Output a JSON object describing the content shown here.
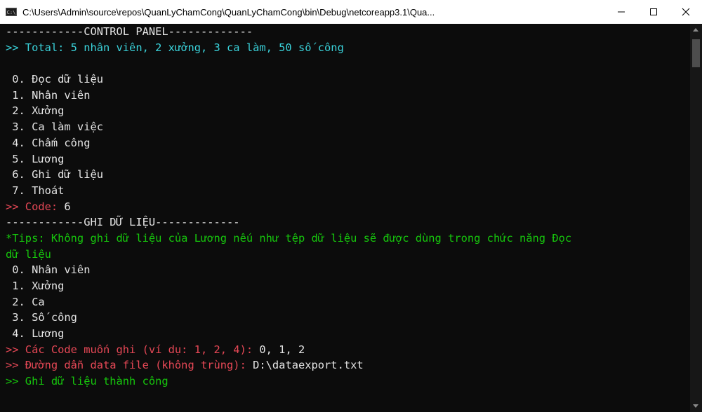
{
  "window": {
    "app_icon": "C:\\",
    "title": "C:\\Users\\Admin\\source\\repos\\QuanLyChamCong\\QuanLyChamCong\\bin\\Debug\\netcoreapp3.1\\Qua...",
    "icons": {
      "app": "console-app-icon",
      "minimize": "minimize-icon",
      "maximize": "maximize-icon",
      "close": "close-icon"
    }
  },
  "colors": {
    "cyan": "#3ad3db",
    "white": "#e5e5e5",
    "red": "#e74856",
    "green": "#16c60c"
  },
  "console": {
    "header_panel": "------------CONTROL PANEL-------------",
    "total_line": ">> Total: 5 nhân viên, 2 xưởng, 3 ca làm, 50 số công",
    "blank": "",
    "menu": [
      " 0. Đọc dữ liệu",
      " 1. Nhân viên",
      " 2. Xưởng",
      " 3. Ca làm việc",
      " 4. Chấm công",
      " 5. Lương",
      " 6. Ghi dữ liệu",
      " 7. Thoát"
    ],
    "code_prompt": ">> Code: ",
    "code_value": "6",
    "header_write": "------------GHI DỮ LIỆU-------------",
    "tips_line1": "*Tips: Không ghi dữ liệu của Lương nếu như tệp dữ liệu sẽ được dùng trong chức năng Đọc",
    "tips_line2": "dữ liệu",
    "write_menu": [
      " 0. Nhân viên",
      " 1. Xưởng",
      " 2. Ca",
      " 3. Số công",
      " 4. Lương"
    ],
    "codes_prompt": ">> Các Code muốn ghi (ví dụ: 1, 2, 4): ",
    "codes_value": "0, 1, 2",
    "path_prompt": ">> Đường dẫn data file (không trùng): ",
    "path_value": "D:\\dataexport.txt",
    "success": ">> Ghi dữ liệu thành công"
  }
}
